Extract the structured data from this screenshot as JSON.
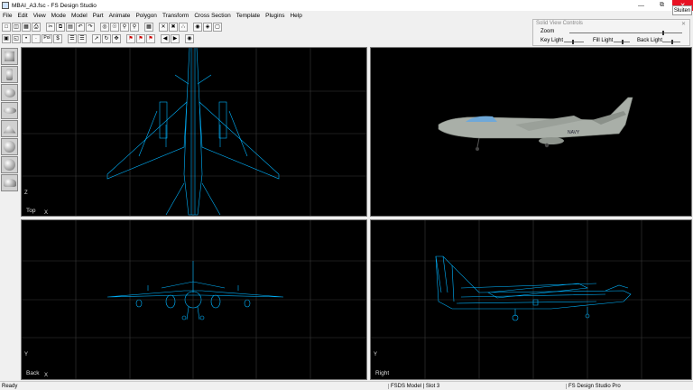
{
  "window": {
    "title": "MBAI_A3.fsc - FS Design Studio"
  },
  "menu": [
    "File",
    "Edit",
    "View",
    "Mode",
    "Model",
    "Part",
    "Animate",
    "Polygon",
    "Transform",
    "Cross Section",
    "Template",
    "Plugins",
    "Help"
  ],
  "toolbar1": [
    "new-icon",
    "open-icon",
    "save-icon",
    "print-icon",
    "cut-icon",
    "copy-icon",
    "paste-icon",
    "undo-icon",
    "redo-icon",
    "select-icon",
    "light-icon",
    "zoom-in-icon",
    "zoom-out-icon",
    "grid-icon",
    "scale-x-icon",
    "scale-y-icon",
    "scale-z-icon",
    "eye-icon",
    "render-icon",
    "wire-icon"
  ],
  "toolbar2": [
    "frame-icon",
    "copy-part-icon",
    "dot-icon",
    "point-icon",
    "poly-icon",
    "dollar-icon",
    "list-icon",
    "list2-icon",
    "arrow-icon",
    "rotate-icon",
    "move-icon",
    "mirror-icon",
    "flag1-icon",
    "flag2-icon",
    "flag3-icon",
    "prev-icon",
    "next-icon",
    "binoculars-icon"
  ],
  "toolbar2_labels": {
    "poly": "Pol"
  },
  "leftbar": [
    "cube-icon",
    "cylinder-icon",
    "sphere-icon",
    "disk-icon",
    "cone-icon",
    "hemisphere-icon",
    "torus-icon",
    "shell-icon"
  ],
  "viewports": {
    "top": {
      "label": "Top",
      "axis_v": "Z",
      "axis_h": "X"
    },
    "back": {
      "label": "Back",
      "axis_v": "Y",
      "axis_h": "X"
    },
    "right": {
      "label": "Right",
      "axis_v": "Y",
      "axis_h": ""
    }
  },
  "solid_controls": {
    "title": "Solid View Controls",
    "zoom": "Zoom",
    "key_light": "Key Light",
    "fill_light": "Fill Light",
    "back_light": "Back Light",
    "zoom_level": 0.82,
    "key_level": 0.4,
    "fill_level": 0.5,
    "back_level": 0.5
  },
  "sluiten": "Sluiten",
  "status": {
    "left": "Ready",
    "mid": "FSDS Model | Slot 3",
    "right": "FS Design Studio Pro"
  },
  "aircraft_text": "NAVY",
  "colors": {
    "wire": "#00b4ff",
    "grid": "#3a3a3a",
    "viewport_bg": "#000000"
  }
}
